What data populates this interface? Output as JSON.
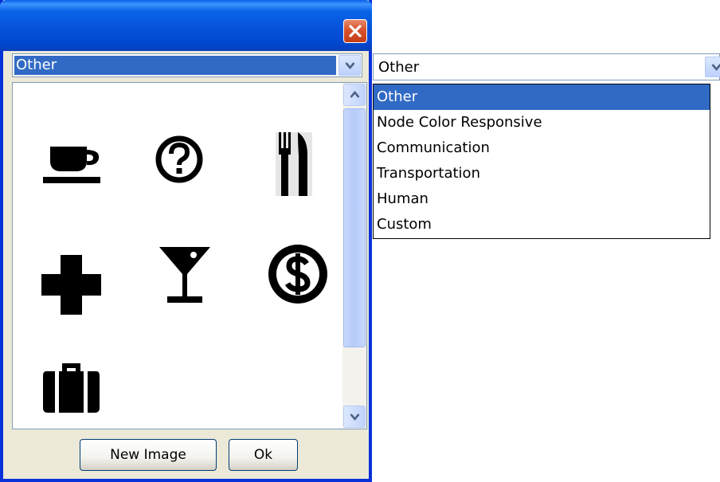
{
  "dialog": {
    "category_value": "Other",
    "buttons": {
      "new_image": "New Image",
      "ok": "Ok"
    },
    "icons": [
      "coffee-cup",
      "question-mark",
      "fork-knife",
      "plus-cross",
      "cocktail-glass",
      "dollar-coin",
      "briefcase"
    ]
  },
  "dropdown": {
    "value": "Other",
    "options": [
      "Other",
      "Node Color Responsive",
      "Communication",
      "Transportation",
      "Human",
      "Custom"
    ],
    "selected_index": 0
  },
  "colors": {
    "title_blue": "#0054e3",
    "selection_blue": "#316ac5",
    "close_red": "#d6522c"
  }
}
